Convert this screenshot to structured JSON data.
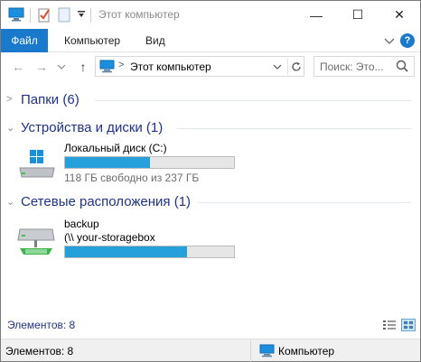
{
  "window": {
    "title": "Этот компьютер",
    "controls": {
      "minimize": "—",
      "maximize": "☐",
      "close": "✕"
    }
  },
  "ribbon": {
    "file_tab": "Файл",
    "tabs": [
      "Компьютер",
      "Вид"
    ],
    "help": "?"
  },
  "nav": {
    "back": "←",
    "forward": "→",
    "recent": "⌄",
    "up": "↑",
    "address": "Этот компьютер",
    "search_placeholder": "Поиск: Это..."
  },
  "groups": {
    "folders": {
      "label": "Папки (6)"
    },
    "devices": {
      "label": "Устройства и диски (1)"
    },
    "network": {
      "label": "Сетевые расположения (1)"
    }
  },
  "items": {
    "local_disk": {
      "name": "Локальный диск (C:)",
      "free_text": "118 ГБ свободно из 237 ГБ",
      "used_fraction": 0.5
    },
    "network_drive": {
      "name": "backup",
      "path": "(\\\\ your-storagebox",
      "used_fraction": 0.72
    }
  },
  "footer": {
    "count": "Элементов: 8"
  },
  "statusbar": {
    "count": "Элементов: 8",
    "location": "Компьютер"
  },
  "colors": {
    "accent": "#1979ca",
    "header_text": "#1e3287",
    "bar_fill": "#26a0da"
  }
}
